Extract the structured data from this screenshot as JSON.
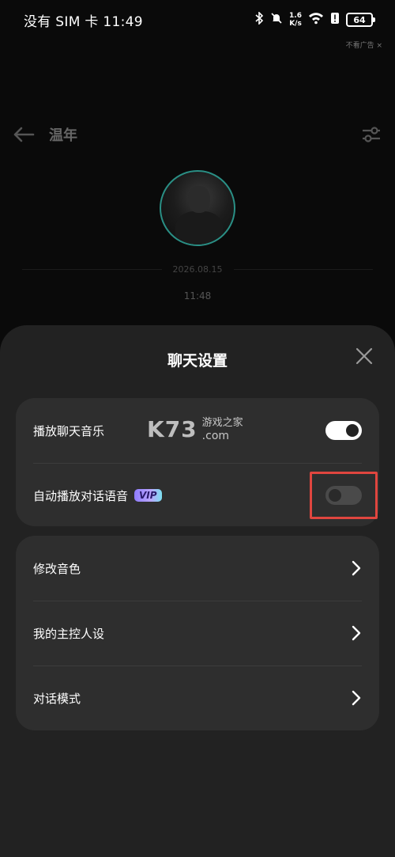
{
  "status_bar": {
    "carrier_time": "没有 SIM 卡 11:49",
    "net_speed_value": "1.6",
    "net_speed_unit": "K/s",
    "battery": "64"
  },
  "ad_label": "不看广告 ×",
  "chat": {
    "title": "温年",
    "date": "2026.08.15",
    "time": "11:48"
  },
  "sheet": {
    "title": "聊天设置",
    "toggles": [
      {
        "label": "播放聊天音乐",
        "state": "on"
      },
      {
        "label": "自动播放对话语音",
        "badge": "VIP",
        "state": "off"
      }
    ],
    "links": [
      {
        "label": "修改音色"
      },
      {
        "label": "我的主控人设"
      },
      {
        "label": "对话模式"
      }
    ]
  },
  "watermark": {
    "logo": "K73",
    "cn": "游戏之家",
    "en": ".com"
  },
  "colors": {
    "highlight": "#e0463f",
    "sheet_bg": "#222222",
    "card_bg": "#2e2e2e"
  }
}
